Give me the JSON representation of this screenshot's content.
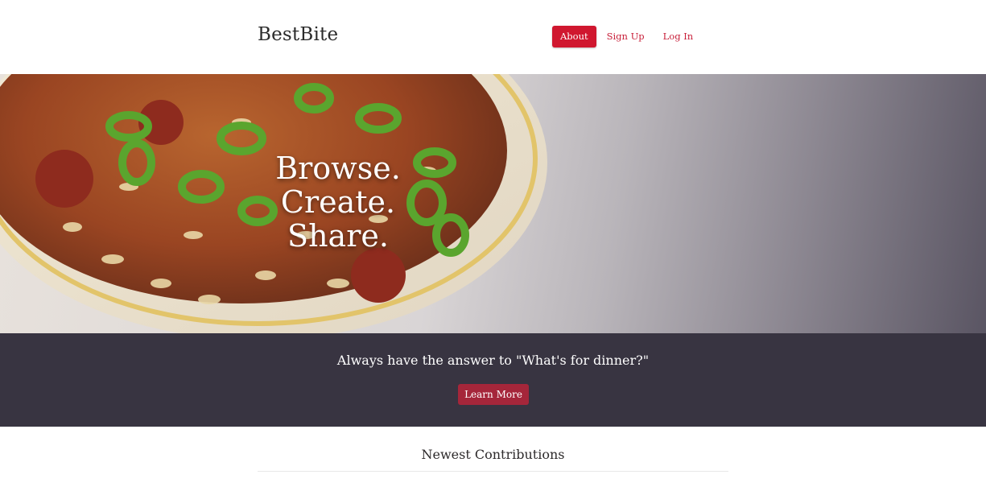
{
  "brand": {
    "name": "BestBite"
  },
  "nav": {
    "about": "About",
    "signup": "Sign Up",
    "login": "Log In"
  },
  "hero": {
    "line1": "Browse.",
    "line2": "Create.",
    "line3": "Share."
  },
  "band": {
    "title": "Always have the answer to \"What's for dinner?\"",
    "button": "Learn More"
  },
  "newest": {
    "title": "Newest Contributions"
  },
  "colors": {
    "accent": "#d0172f",
    "band": "#383441",
    "button": "#a5263a"
  }
}
